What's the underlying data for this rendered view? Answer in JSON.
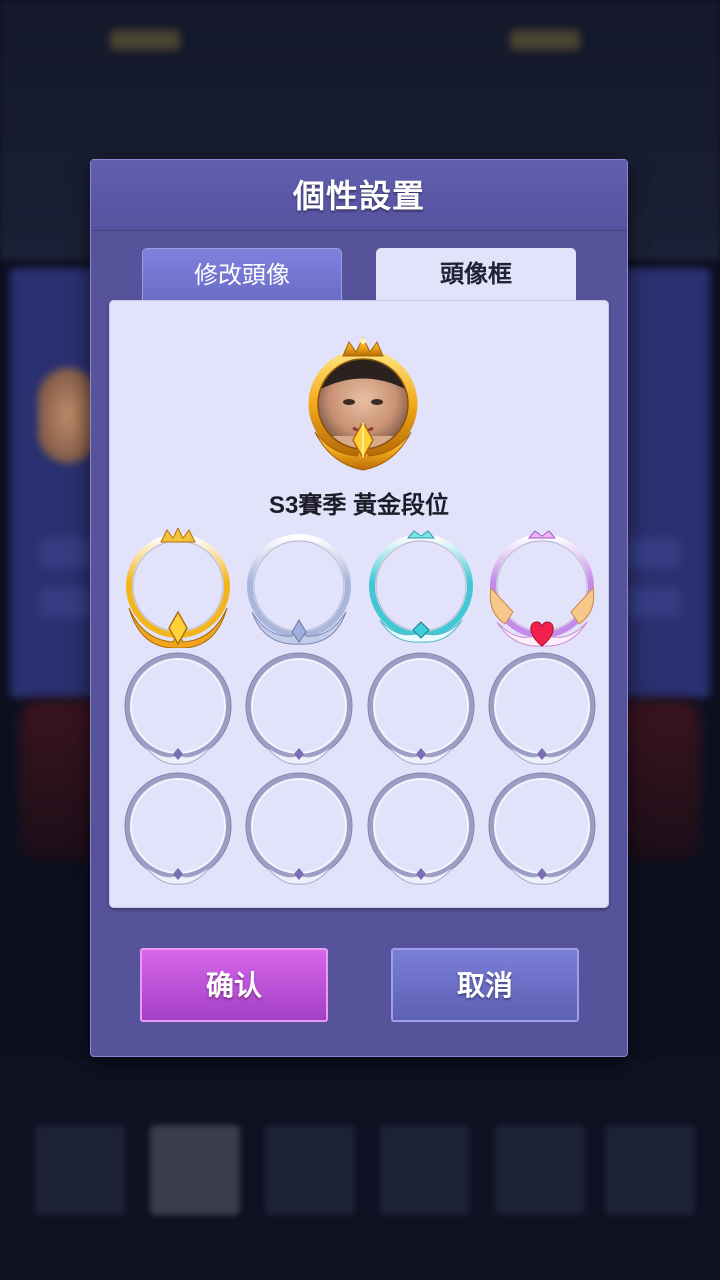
{
  "dialog": {
    "title": "個性設置",
    "tabs": [
      {
        "label": "修改頭像",
        "active": false
      },
      {
        "label": "頭像框",
        "active": true
      }
    ],
    "preview": {
      "caption": "S3賽季 黃金段位",
      "frame": "gold-crown-frame",
      "avatar": "user-avatar-photo"
    },
    "frames": [
      {
        "icon": "gold-crown-frame",
        "accent": "#f2b51e",
        "locked": false
      },
      {
        "icon": "silver-wing-frame",
        "accent": "#a9b6dc",
        "locked": false
      },
      {
        "icon": "cyan-gem-frame",
        "accent": "#41c8d4",
        "locked": false
      },
      {
        "icon": "pink-heart-frame",
        "accent": "#c68aea",
        "locked": false
      },
      {
        "icon": "locked-frame",
        "accent": "#b6b8d8",
        "locked": true
      },
      {
        "icon": "locked-frame",
        "accent": "#b6b8d8",
        "locked": true
      },
      {
        "icon": "locked-frame",
        "accent": "#b6b8d8",
        "locked": true
      },
      {
        "icon": "locked-frame",
        "accent": "#b6b8d8",
        "locked": true
      },
      {
        "icon": "locked-frame",
        "accent": "#b6b8d8",
        "locked": true
      },
      {
        "icon": "locked-frame",
        "accent": "#b6b8d8",
        "locked": true
      },
      {
        "icon": "locked-frame",
        "accent": "#b6b8d8",
        "locked": true
      },
      {
        "icon": "locked-frame",
        "accent": "#b6b8d8",
        "locked": true
      }
    ],
    "buttons": {
      "confirm": "确认",
      "cancel": "取消"
    }
  },
  "colors": {
    "dialog_bg": "#56539a",
    "panel_bg": "#e2e2fa",
    "confirm": "#c053dc",
    "cancel": "#6b6fc6"
  }
}
